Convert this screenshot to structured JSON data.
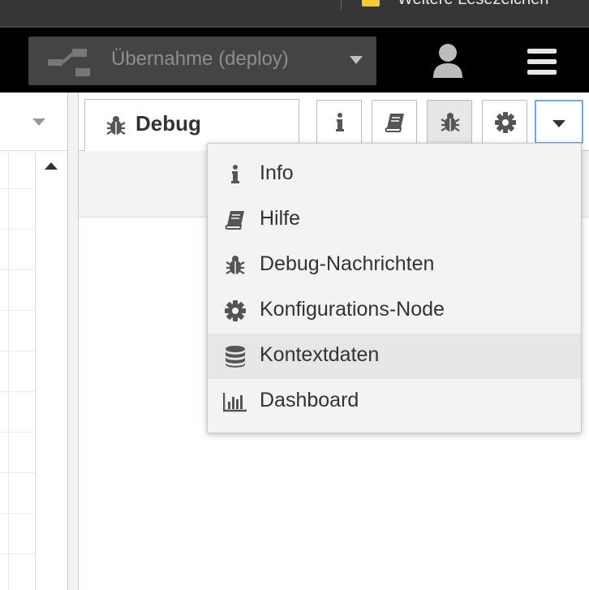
{
  "browser": {
    "bookmark_folder": "Weitere Lesezeichen"
  },
  "header": {
    "deploy_label": "Übernahme (deploy)",
    "icons": [
      "deploy-icon",
      "deploy-dropdown-caret",
      "user-icon",
      "hamburger-menu-icon"
    ]
  },
  "sidebar": {
    "active_tab": {
      "label": "Debug",
      "icon": "bug-icon"
    },
    "buttons": [
      {
        "name": "info",
        "icon": "info-icon",
        "selected": false
      },
      {
        "name": "help",
        "icon": "book-icon",
        "selected": false
      },
      {
        "name": "debug",
        "icon": "bug-icon",
        "selected": true
      },
      {
        "name": "config",
        "icon": "gear-icon",
        "selected": false
      },
      {
        "name": "more",
        "icon": "caret-down-icon",
        "selected": false
      }
    ],
    "menu": {
      "items": [
        {
          "label": "Info",
          "icon": "info-icon"
        },
        {
          "label": "Hilfe",
          "icon": "book-icon"
        },
        {
          "label": "Debug-Nachrichten",
          "icon": "bug-icon"
        },
        {
          "label": "Konfigurations-Node",
          "icon": "gear-icon"
        },
        {
          "label": "Kontextdaten",
          "icon": "database-icon",
          "hovered": true
        },
        {
          "label": "Dashboard",
          "icon": "bar-chart-icon"
        }
      ]
    }
  },
  "colors": {
    "header_bg": "#000000",
    "deploy_bg": "#444444",
    "menu_bg": "#f3f3f3",
    "menu_hover": "#e6e6e6",
    "focus_border": "#6fa8dc"
  }
}
